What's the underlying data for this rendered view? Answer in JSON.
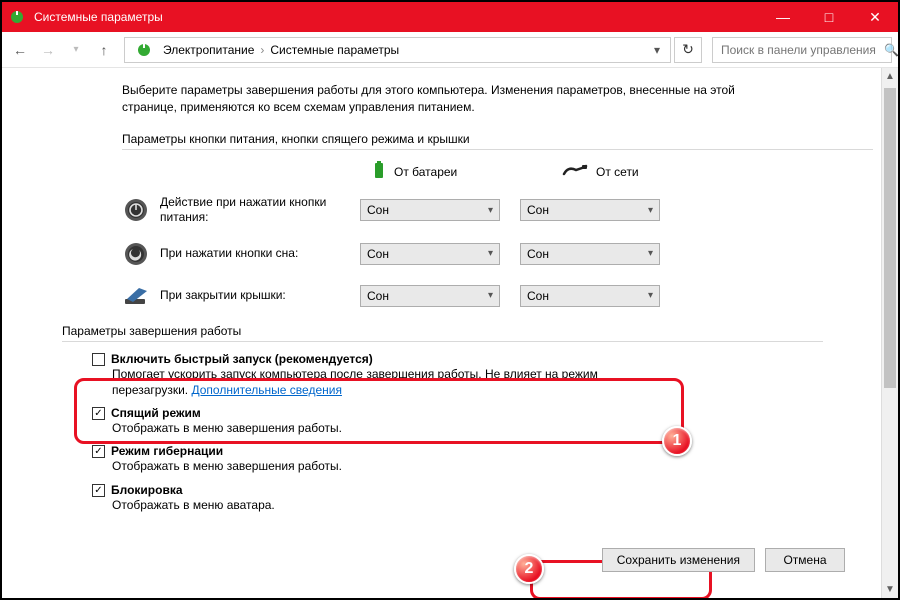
{
  "window": {
    "title": "Системные параметры"
  },
  "breadcrumb": {
    "item1": "Электропитание",
    "item2": "Системные параметры"
  },
  "search": {
    "placeholder": "Поиск в панели управления"
  },
  "intro": "Выберите параметры завершения работы для этого компьютера. Изменения параметров, внесенные на этой странице, применяются ко всем схемам управления питанием.",
  "section1_title": "Параметры кнопки питания, кнопки спящего режима и крышки",
  "columns": {
    "battery": "От батареи",
    "plugged": "От сети"
  },
  "rows": {
    "power": {
      "label": "Действие при нажатии кнопки питания:",
      "batt": "Сон",
      "plug": "Сон"
    },
    "sleep": {
      "label": "При нажатии кнопки сна:",
      "batt": "Сон",
      "plug": "Сон"
    },
    "lid": {
      "label": "При закрытии крышки:",
      "batt": "Сон",
      "plug": "Сон"
    }
  },
  "section2_title": "Параметры завершения работы",
  "shutdown": {
    "fast": {
      "label": "Включить быстрый запуск (рекомендуется)",
      "desc": "Помогает ускорить запуск компьютера после завершения работы. Не влияет на режим перезагрузки. ",
      "link": "Дополнительные сведения"
    },
    "sleep": {
      "label": "Спящий режим",
      "desc": "Отображать в меню завершения работы."
    },
    "hiber": {
      "label": "Режим гибернации",
      "desc": "Отображать в меню завершения работы."
    },
    "lock": {
      "label": "Блокировка",
      "desc": "Отображать в меню аватара."
    }
  },
  "buttons": {
    "save": "Сохранить изменения",
    "cancel": "Отмена"
  },
  "badges": {
    "b1": "1",
    "b2": "2"
  }
}
